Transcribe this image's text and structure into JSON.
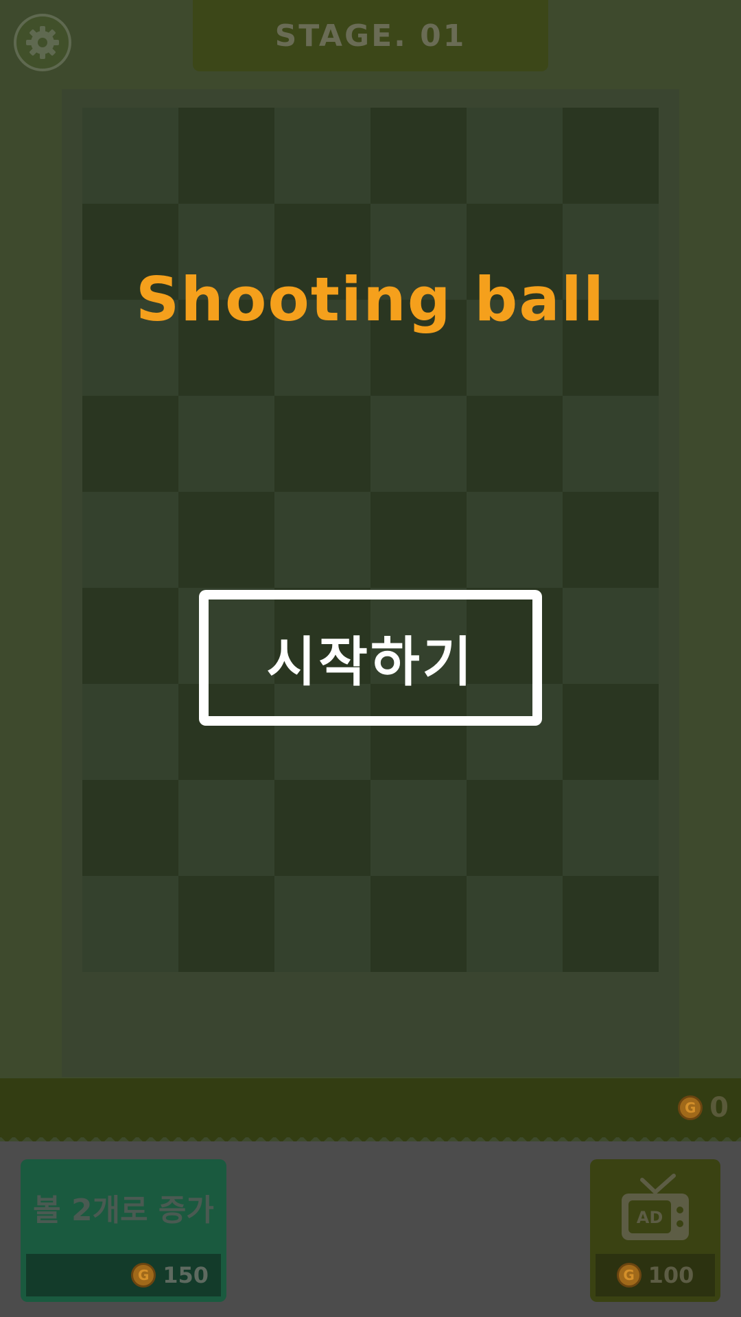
{
  "header": {
    "stage_label": "STAGE. 01",
    "settings_icon": "gear-icon"
  },
  "title": "Shooting ball",
  "start_button": {
    "label": "시작하기"
  },
  "board": {
    "columns": 6,
    "rows": 9
  },
  "coins": {
    "icon": "coin-icon",
    "coin_symbol": "G",
    "count": "0"
  },
  "shop": {
    "add_ball_item": {
      "label": "볼 2개로 증가",
      "price": "150",
      "coin_symbol": "G"
    },
    "ad_item": {
      "icon": "tv-ad-icon",
      "ad_text": "AD",
      "price": "100",
      "coin_symbol": "G"
    }
  },
  "colors": {
    "title": "#f5a01c",
    "board_light": "#34412d",
    "board_dark": "#2a3621",
    "item_green": "#1a5a3f",
    "ad_olive": "#3a4212"
  }
}
